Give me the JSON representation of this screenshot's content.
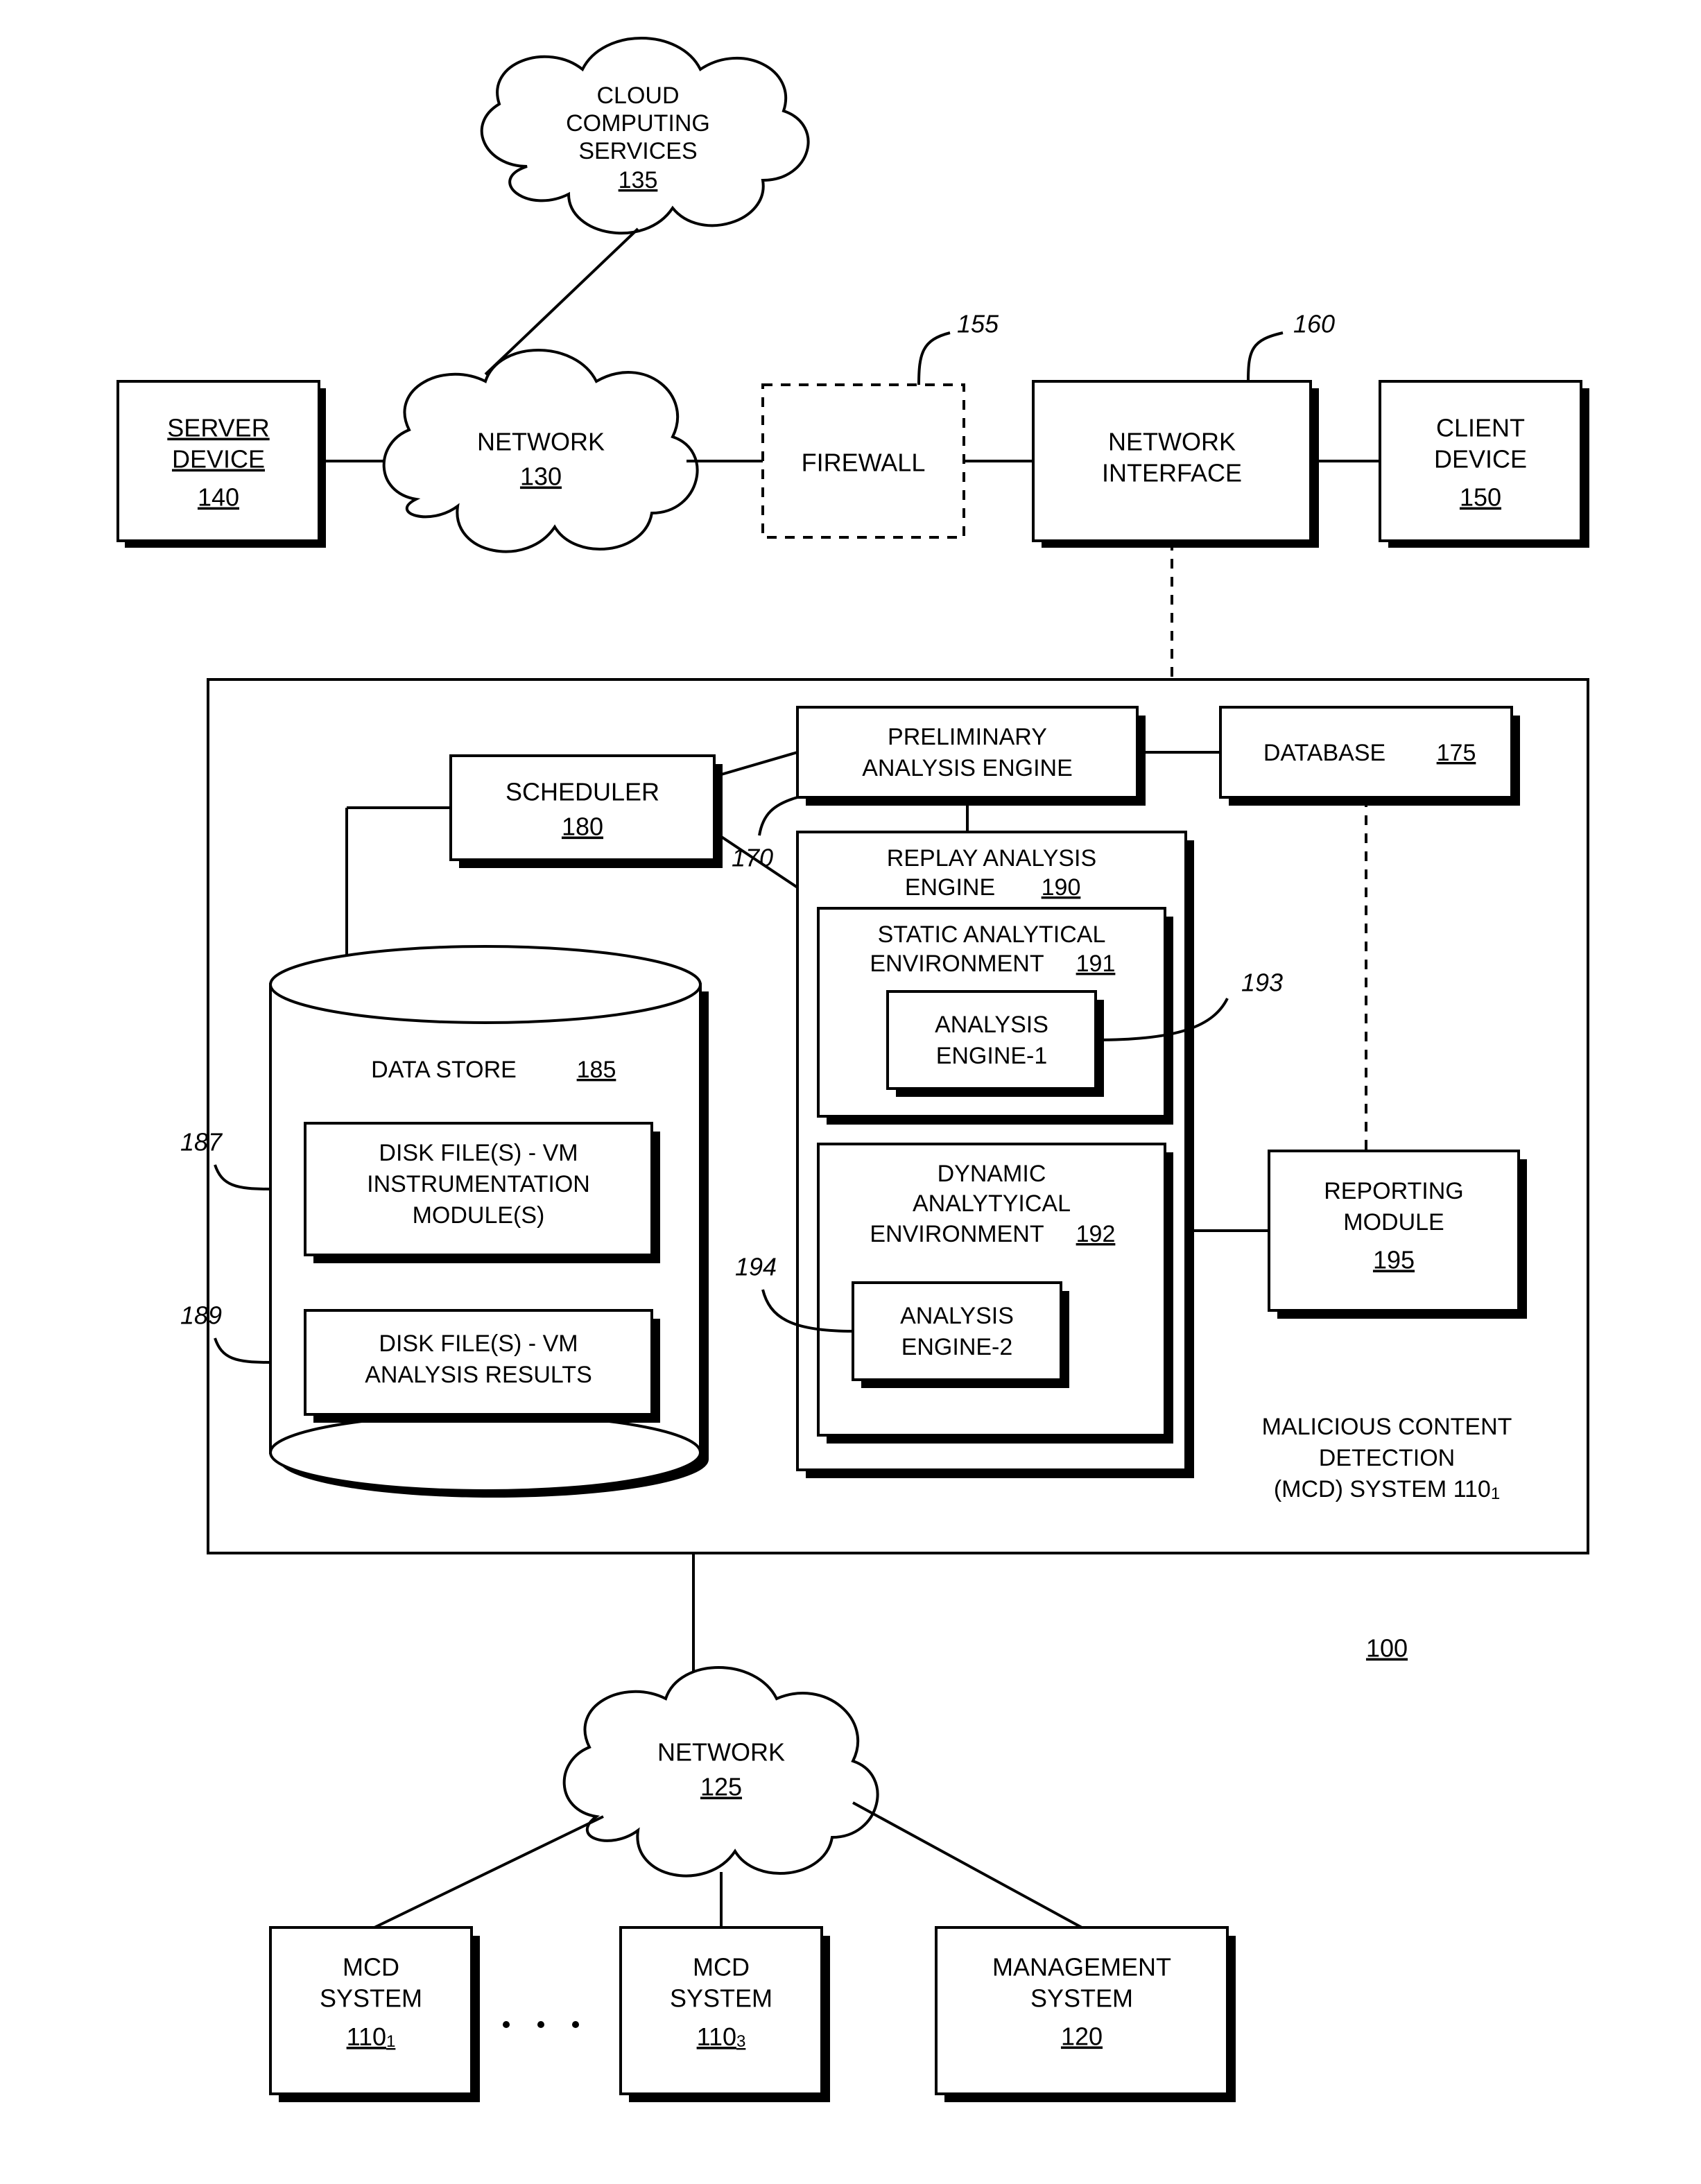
{
  "figure_id": "100",
  "nodes": {
    "cloud_services": {
      "l1": "CLOUD",
      "l2": "COMPUTING",
      "l3": "SERVICES",
      "ref": "135"
    },
    "server_device": {
      "l1": "SERVER",
      "l2": "DEVICE",
      "ref": "140"
    },
    "network_top": {
      "l1": "NETWORK",
      "ref": "130"
    },
    "firewall": {
      "l1": "FIREWALL",
      "callout": "155"
    },
    "net_iface": {
      "l1": "NETWORK",
      "l2": "INTERFACE",
      "callout": "160"
    },
    "client_device": {
      "l1": "CLIENT",
      "l2": "DEVICE",
      "ref": "150"
    },
    "prelim": {
      "l1": "PRELIMINARY",
      "l2": "ANALYSIS ENGINE",
      "callout": "170"
    },
    "database": {
      "l1": "DATABASE",
      "ref": "175"
    },
    "scheduler": {
      "l1": "SCHEDULER",
      "ref": "180"
    },
    "replay": {
      "l1": "REPLAY ANALYSIS",
      "l2": "ENGINE",
      "ref": "190"
    },
    "static_env": {
      "l1": "STATIC ANALYTICAL",
      "l2": "ENVIRONMENT",
      "ref": "191"
    },
    "ae1": {
      "l1": "ANALYSIS",
      "l2": "ENGINE-1",
      "callout": "193"
    },
    "dyn_env": {
      "l1": "DYNAMIC",
      "l2": "ANALYTYICAL",
      "l3": "ENVIRONMENT",
      "ref": "192"
    },
    "ae2": {
      "l1": "ANALYSIS",
      "l2": "ENGINE-2",
      "callout": "194"
    },
    "reporting": {
      "l1": "REPORTING",
      "l2": "MODULE",
      "ref": "195"
    },
    "data_store": {
      "l1": "DATA STORE",
      "ref": "185"
    },
    "disk1": {
      "l1": "DISK FILE(S) - VM",
      "l2": "INSTRUMENTATION",
      "l3": "MODULE(S)",
      "callout": "187"
    },
    "disk2": {
      "l1": "DISK FILE(S) - VM",
      "l2": "ANALYSIS RESULTS",
      "callout": "189"
    },
    "mcd_label": {
      "l1": "MALICIOUS CONTENT",
      "l2": "DETECTION",
      "l3": "(MCD) SYSTEM",
      "ref": "110",
      "sub": "1"
    },
    "network_bot": {
      "l1": "NETWORK",
      "ref": "125"
    },
    "mcd2": {
      "l1": "MCD",
      "l2": "SYSTEM",
      "ref": "110",
      "sub": "1"
    },
    "mcd3": {
      "l1": "MCD",
      "l2": "SYSTEM",
      "ref": "110",
      "sub2": "3"
    },
    "mgmt": {
      "l1": "MANAGEMENT",
      "l2": "SYSTEM",
      "ref": "120"
    }
  }
}
